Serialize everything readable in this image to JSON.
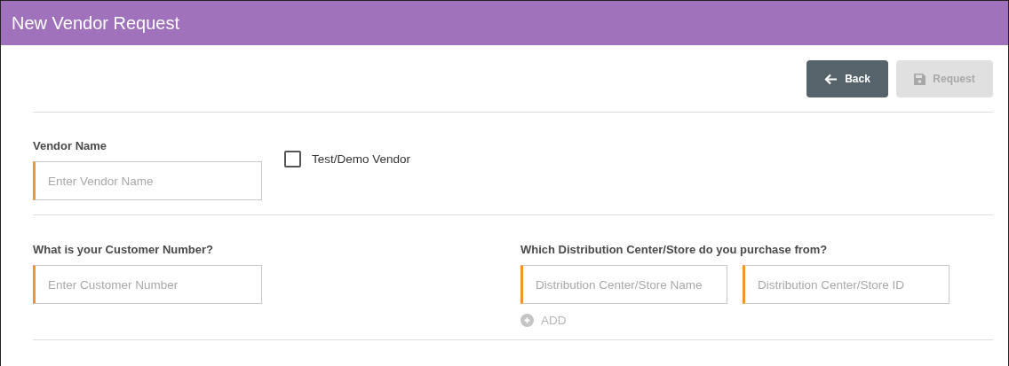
{
  "header": {
    "title": "New Vendor Request"
  },
  "actions": [
    {
      "kind": "back",
      "label": "Back",
      "disabled": false
    },
    {
      "kind": "save",
      "label": "Request",
      "disabled": true
    }
  ],
  "vendor": {
    "label": "Vendor Name",
    "placeholder": "Enter Vendor Name",
    "test_demo": {
      "label": "Test/Demo Vendor",
      "checked": false
    }
  },
  "customer": {
    "label": "What is your Customer Number?",
    "placeholder": "Enter Customer Number"
  },
  "distribution": {
    "label": "Which Distribution Center/Store do you purchase from?",
    "fields": [
      {
        "placeholder": "Distribution Center/Store Name"
      },
      {
        "placeholder": "Distribution Center/Store ID"
      }
    ],
    "add": {
      "label": "ADD",
      "disabled": true
    }
  }
}
